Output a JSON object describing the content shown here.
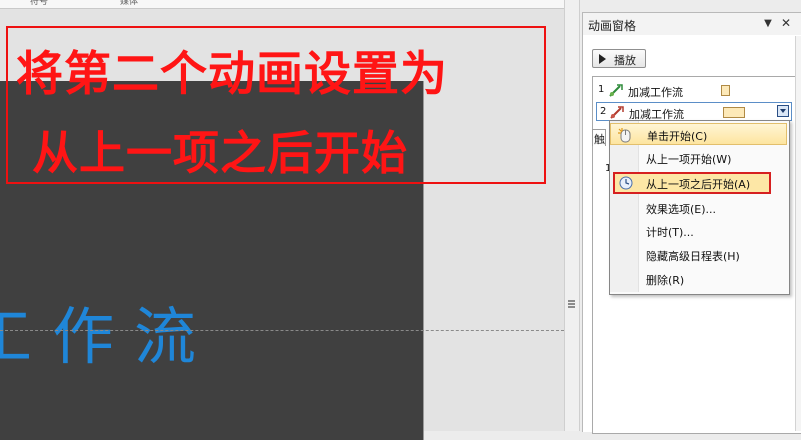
{
  "ribbon": {
    "tab1": "符号",
    "tab2": "媒体"
  },
  "slide": {
    "text": "工作流"
  },
  "callout": {
    "line1": "将第二个动画设置为",
    "line2": "从上一项之后开始"
  },
  "pane": {
    "title": "动画窗格",
    "dropdown_glyph": "▼",
    "close_glyph": "✕",
    "play_label": "播放",
    "items": [
      {
        "num": "1",
        "name": "加减工作流"
      },
      {
        "num": "2",
        "name": "加减工作流"
      }
    ],
    "trigger_tab": "触",
    "under_num": "1"
  },
  "context_menu": {
    "items": [
      {
        "label": "单击开始(C)",
        "icon": "mouse-click-icon"
      },
      {
        "label": "从上一项开始(W)",
        "icon": "none"
      },
      {
        "label": "从上一项之后开始(A)",
        "icon": "clock-icon",
        "highlighted": true
      },
      {
        "label": "效果选项(E)...",
        "icon": "none"
      },
      {
        "label": "计时(T)...",
        "icon": "none"
      },
      {
        "label": "隐藏高级日程表(H)",
        "icon": "none"
      },
      {
        "label": "删除(R)",
        "icon": "none"
      }
    ]
  },
  "colors": {
    "callout_red": "#ff1515",
    "slide_bg": "#404040",
    "slide_text_blue": "#1f86d8",
    "menu_highlight": "#fde7a6"
  }
}
